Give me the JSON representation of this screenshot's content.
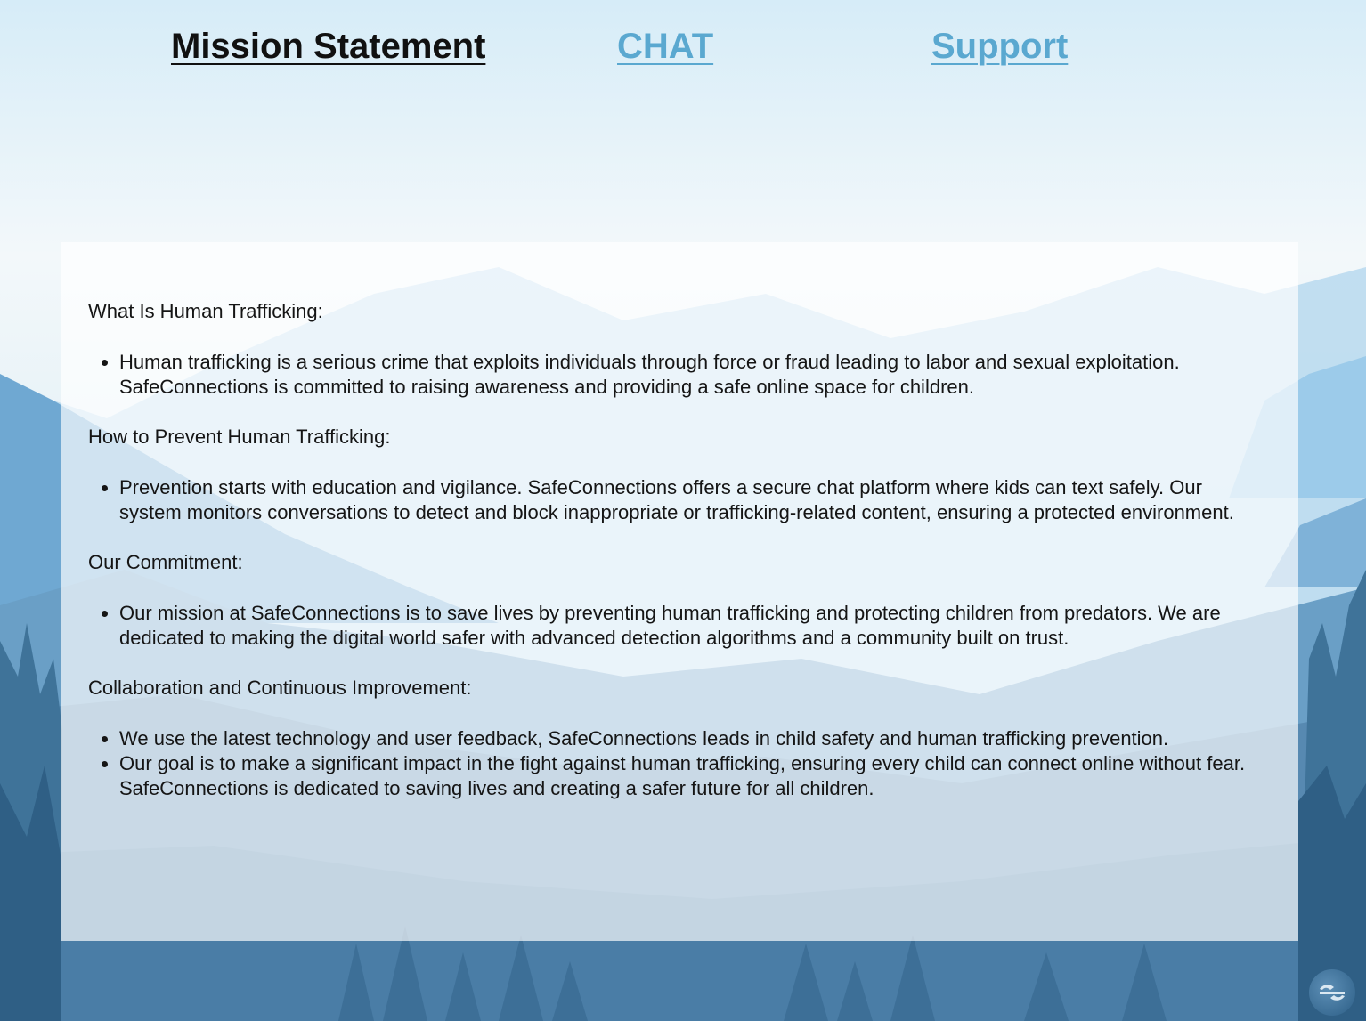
{
  "nav": {
    "mission": "Mission Statement",
    "chat": "CHAT",
    "support": "Support"
  },
  "sections": [
    {
      "heading": "What Is Human Trafficking:",
      "items": [
        "Human trafficking is a serious crime that exploits individuals through force or fraud leading to labor and sexual exploitation. SafeConnections is committed to raising awareness and providing a safe online space for children."
      ]
    },
    {
      "heading": "How to Prevent Human Trafficking:",
      "items": [
        "Prevention starts with education and vigilance. SafeConnections offers a secure chat platform where kids can text safely. Our system monitors conversations to detect and block inappropriate or trafficking-related content, ensuring a protected environment."
      ]
    },
    {
      "heading": "Our Commitment:",
      "items": [
        "Our mission at SafeConnections is to save lives by preventing human trafficking and protecting children from predators. We are dedicated to making the digital world safer with advanced detection algorithms and a community built on trust."
      ]
    },
    {
      "heading": "Collaboration and Continuous Improvement:",
      "items": [
        "We use the latest technology and user feedback, SafeConnections leads in child safety and human trafficking prevention.",
        "Our goal is to make a significant impact in the fight against human trafficking, ensuring every child can connect online without fear. SafeConnections is dedicated to saving lives and creating a safer future for all children."
      ]
    }
  ],
  "colors": {
    "nav_active": "#111111",
    "nav_link": "#5aa8d0"
  },
  "icons": {
    "logo": "safeconnections-logo-icon"
  }
}
